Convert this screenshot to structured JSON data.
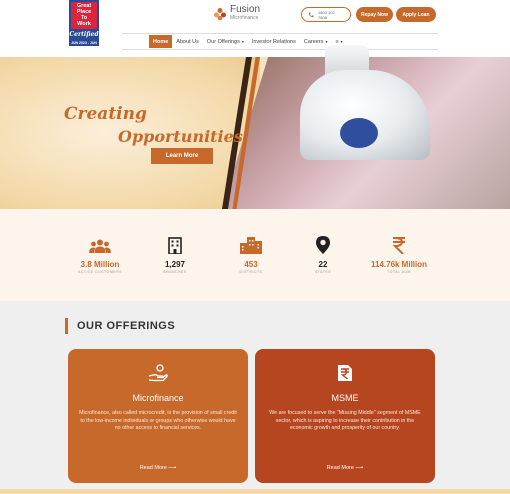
{
  "header": {
    "badge": {
      "line1": "Great",
      "line2": "Place",
      "line3": "To",
      "line4": "Work",
      "certified": "Certified",
      "small": "JUN 2023 - JUN 2024 INDIA"
    },
    "logo": {
      "name": "Fusion",
      "sub": "Microfinance"
    },
    "phone": {
      "line1": "1800 102",
      "line2": "7808"
    },
    "repay_label": "Repay Now",
    "apply_label": "Apply Loan"
  },
  "nav": {
    "items": [
      {
        "label": "Home",
        "active": true
      },
      {
        "label": "About Us"
      },
      {
        "label": "Our Offerings",
        "caret": "▾"
      },
      {
        "label": "Investor Relations"
      },
      {
        "label": "Careers",
        "caret": "▾"
      },
      {
        "label": "≡",
        "caret": "▾"
      }
    ]
  },
  "hero": {
    "line1": "Creating",
    "line2": "Opportunities!",
    "button": "Learn More"
  },
  "stats": [
    {
      "value": "3.8 Million",
      "label": "ACTIVE CUSTOMERS",
      "icon": "people-icon",
      "color": "orange"
    },
    {
      "value": "1,297",
      "label": "BRANCHES",
      "icon": "building-icon",
      "color": "dark"
    },
    {
      "value": "453",
      "label": "DISTRICTS",
      "icon": "city-icon",
      "color": "orange"
    },
    {
      "value": "22",
      "label": "STATES",
      "icon": "location-pin-icon",
      "color": "dark"
    },
    {
      "value": "114.76k Million",
      "label": "TOTAL AUM",
      "icon": "rupee-icon",
      "color": "orange"
    }
  ],
  "offerings": {
    "title": "OUR OFFERINGS",
    "cards": [
      {
        "title": "Microfinance",
        "desc": "Microfinance, also called microcredit, is the provision of small credit to the low-income individuals or groups who otherwise would have no other access to financial services.",
        "more": "Read More ⟶"
      },
      {
        "title": "MSME",
        "desc": "We are focused to serve the \"Missing Middle\" segment of MSME sector, which is aspiring to increase their contribution in the economic growth and prosperity of our country.",
        "more": "Read More ⟶"
      }
    ]
  },
  "colors": {
    "brand": "#c7692b",
    "brand_dark": "#b54620",
    "stats_bg": "#fdf4ec"
  }
}
